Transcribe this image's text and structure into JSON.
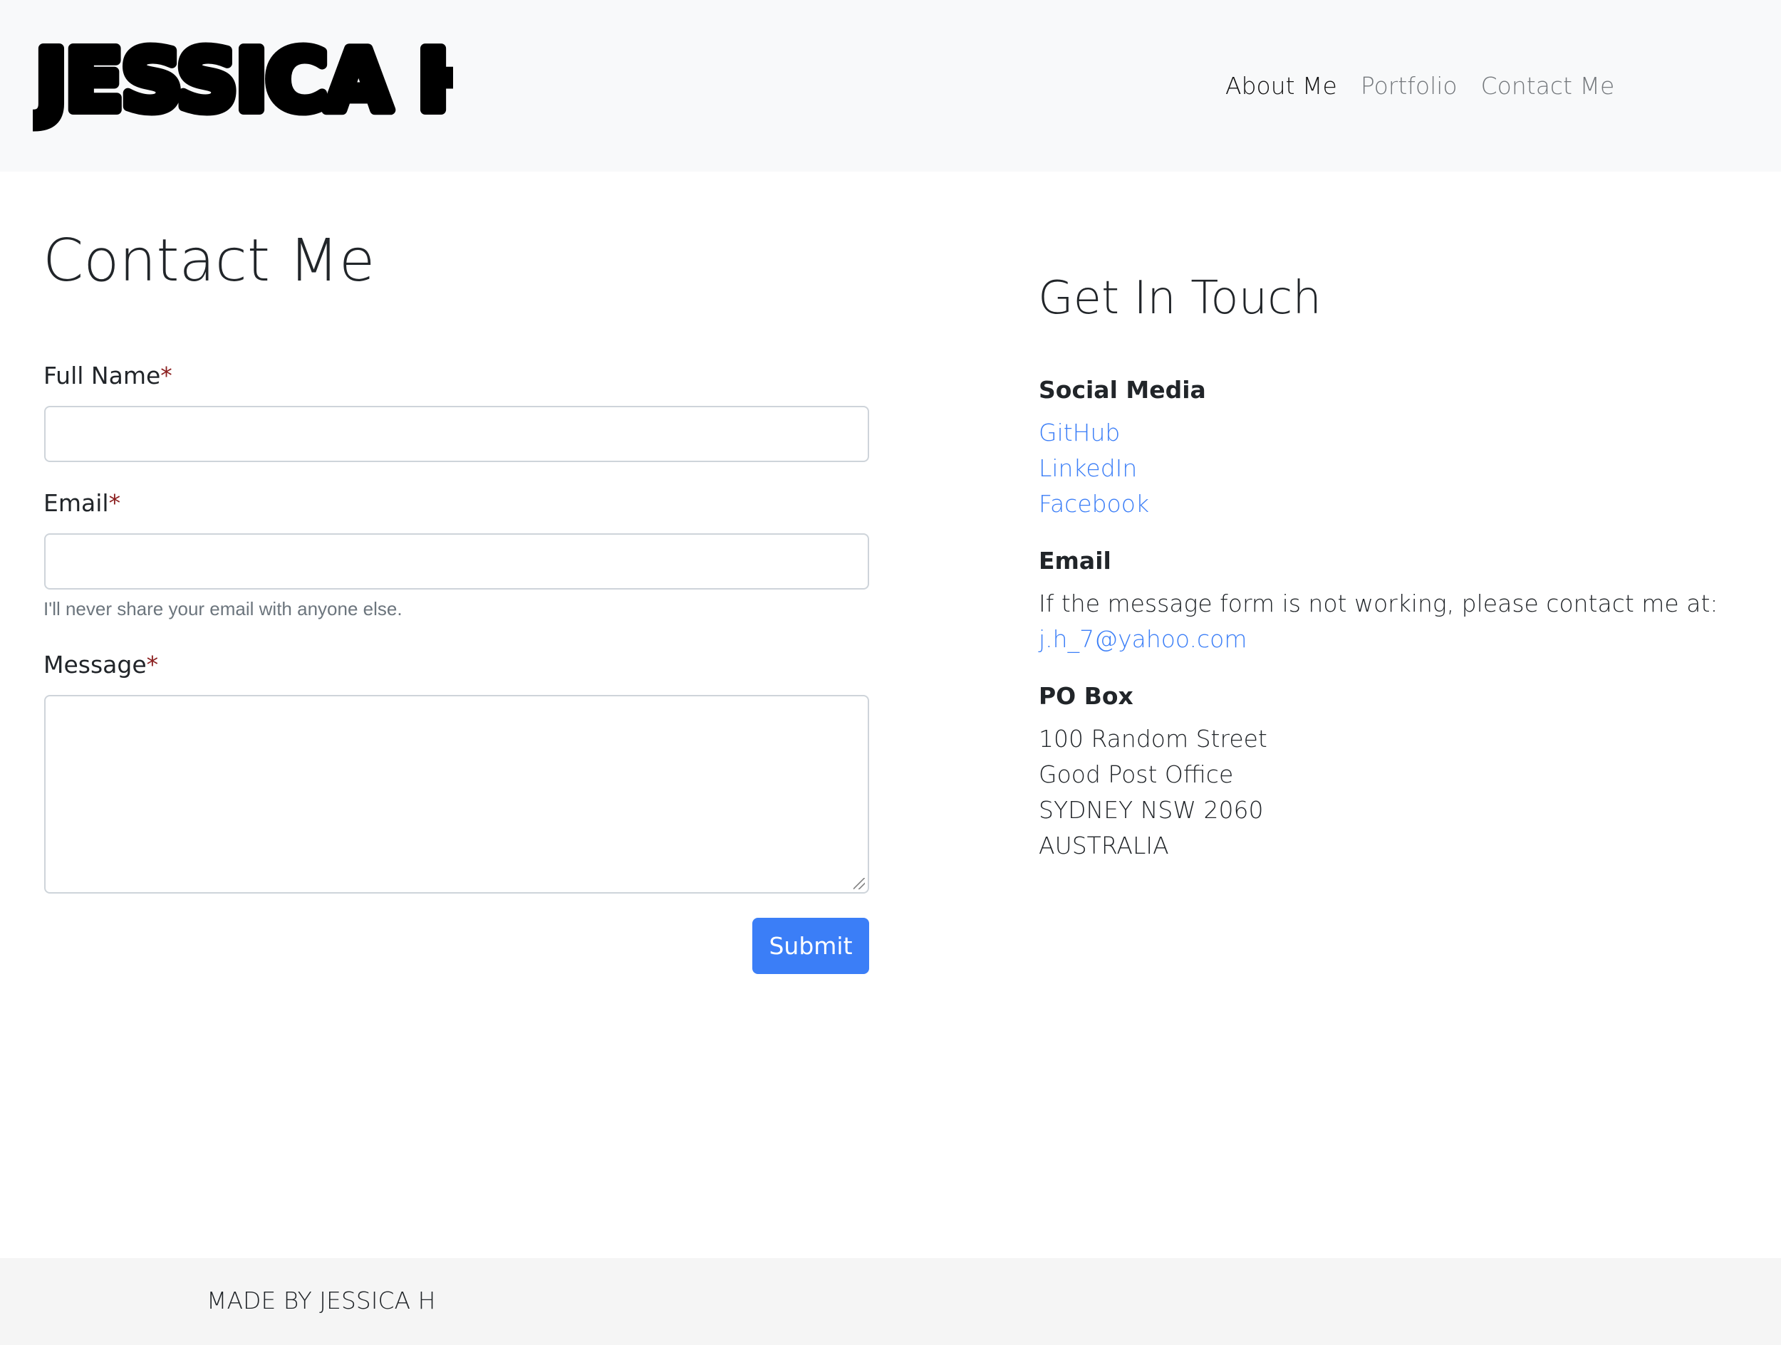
{
  "header": {
    "brand": "JESSICA H",
    "nav": [
      {
        "label": "About Me",
        "active": true
      },
      {
        "label": "Portfolio",
        "active": false
      },
      {
        "label": "Contact Me",
        "active": false
      }
    ]
  },
  "contact_form": {
    "title": "Contact Me",
    "required_marker": "*",
    "fields": {
      "full_name": {
        "label": "Full Name",
        "value": "",
        "placeholder": ""
      },
      "email": {
        "label": "Email",
        "value": "",
        "placeholder": "",
        "help": "I'll never share your email with anyone else."
      },
      "message": {
        "label": "Message",
        "value": "",
        "placeholder": ""
      }
    },
    "submit_label": "Submit"
  },
  "get_in_touch": {
    "title": "Get In Touch",
    "social": {
      "heading": "Social Media",
      "links": [
        "GitHub",
        "LinkedIn",
        "Facebook"
      ]
    },
    "email": {
      "heading": "Email",
      "text": "If the message form is not working, please contact me at:",
      "address": "j.h_7@yahoo.com"
    },
    "po_box": {
      "heading": "PO Box",
      "lines": [
        "100 Random Street",
        "Good Post Office",
        "SYDNEY NSW 2060",
        "AUSTRALIA"
      ]
    }
  },
  "footer": {
    "text": "MADE BY JESSICA H"
  },
  "colors": {
    "navbar_bg": "#f8f9fa",
    "link": "#3b7ef7",
    "button": "#3b7ef7",
    "required": "#8b1e1e",
    "footer_bg": "#f5f5f5"
  }
}
